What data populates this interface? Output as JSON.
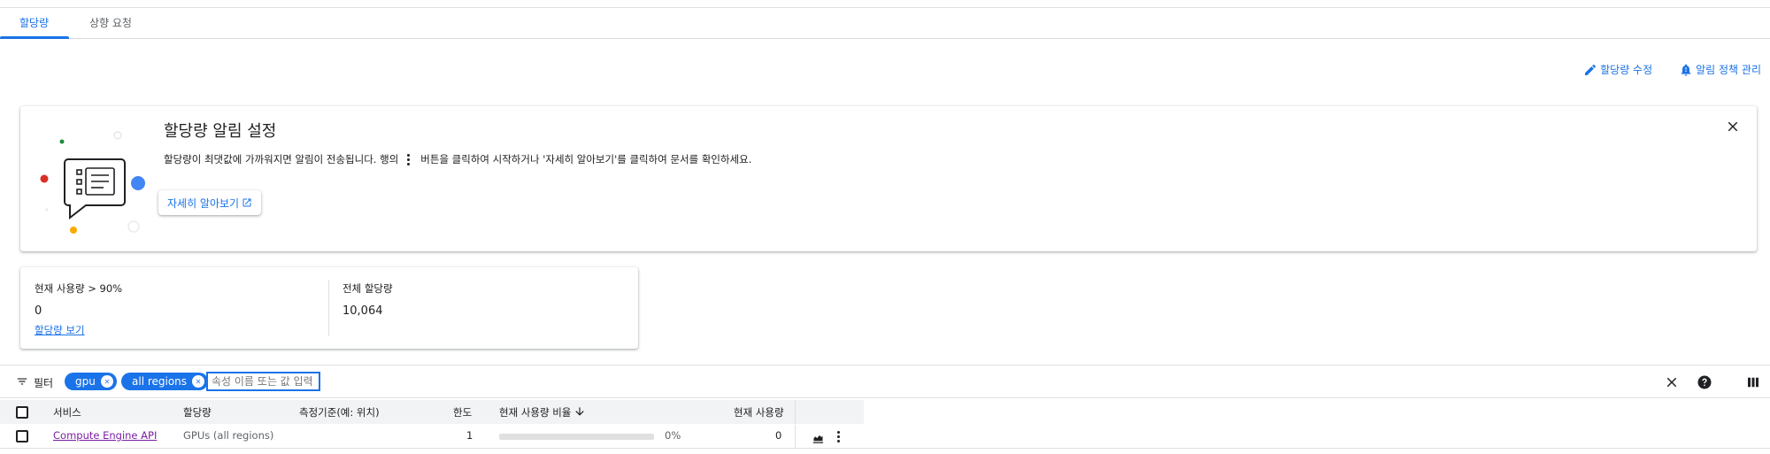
{
  "tabs": [
    {
      "label": "할당량",
      "active": true
    },
    {
      "label": "상향 요청",
      "active": false
    }
  ],
  "actions": {
    "edit_quota": "할당량 수정",
    "manage_alert_policy": "알림 정책 관리"
  },
  "alert_card": {
    "title": "할당량 알림 설정",
    "desc_before": "할당량이 최댓값에 가까워지면 알림이 전송됩니다. 행의",
    "desc_after": "버튼을 클릭하여 시작하거나 '자세히 알아보기'를 클릭하여 문서를 확인하세요.",
    "learn_more": "자세히 알아보기",
    "illustration_icon": "chat-list-illustration",
    "close_icon": "close-icon"
  },
  "stats": {
    "usage_over_label": "현재 사용량 > 90%",
    "usage_over_value": "0",
    "view_quota_link": "할당량 보기",
    "total_quota_label": "전체 할당량",
    "total_quota_value": "10,064"
  },
  "filter": {
    "label": "필터",
    "chips": [
      "gpu",
      "all regions"
    ],
    "placeholder": "속성 이름 또는 값 입력"
  },
  "table": {
    "headers": {
      "service": "서비스",
      "quota": "할당량",
      "dimension": "측정기준(예: 위치)",
      "limit": "한도",
      "usage_ratio": "현재 사용량 비율",
      "current_usage": "현재 사용량"
    },
    "sort": {
      "column": "usage_ratio",
      "direction": "descending"
    },
    "rows": [
      {
        "service": "Compute Engine API",
        "quota": "GPUs (all regions)",
        "dimension": "",
        "limit": "1",
        "usage_percent": 0,
        "usage_percent_label": "0%",
        "current_usage": "0"
      }
    ]
  },
  "colors": {
    "accent": "#1a73e8",
    "link_visited": "#7b1fa2",
    "header_bg": "#f1f3f4"
  }
}
